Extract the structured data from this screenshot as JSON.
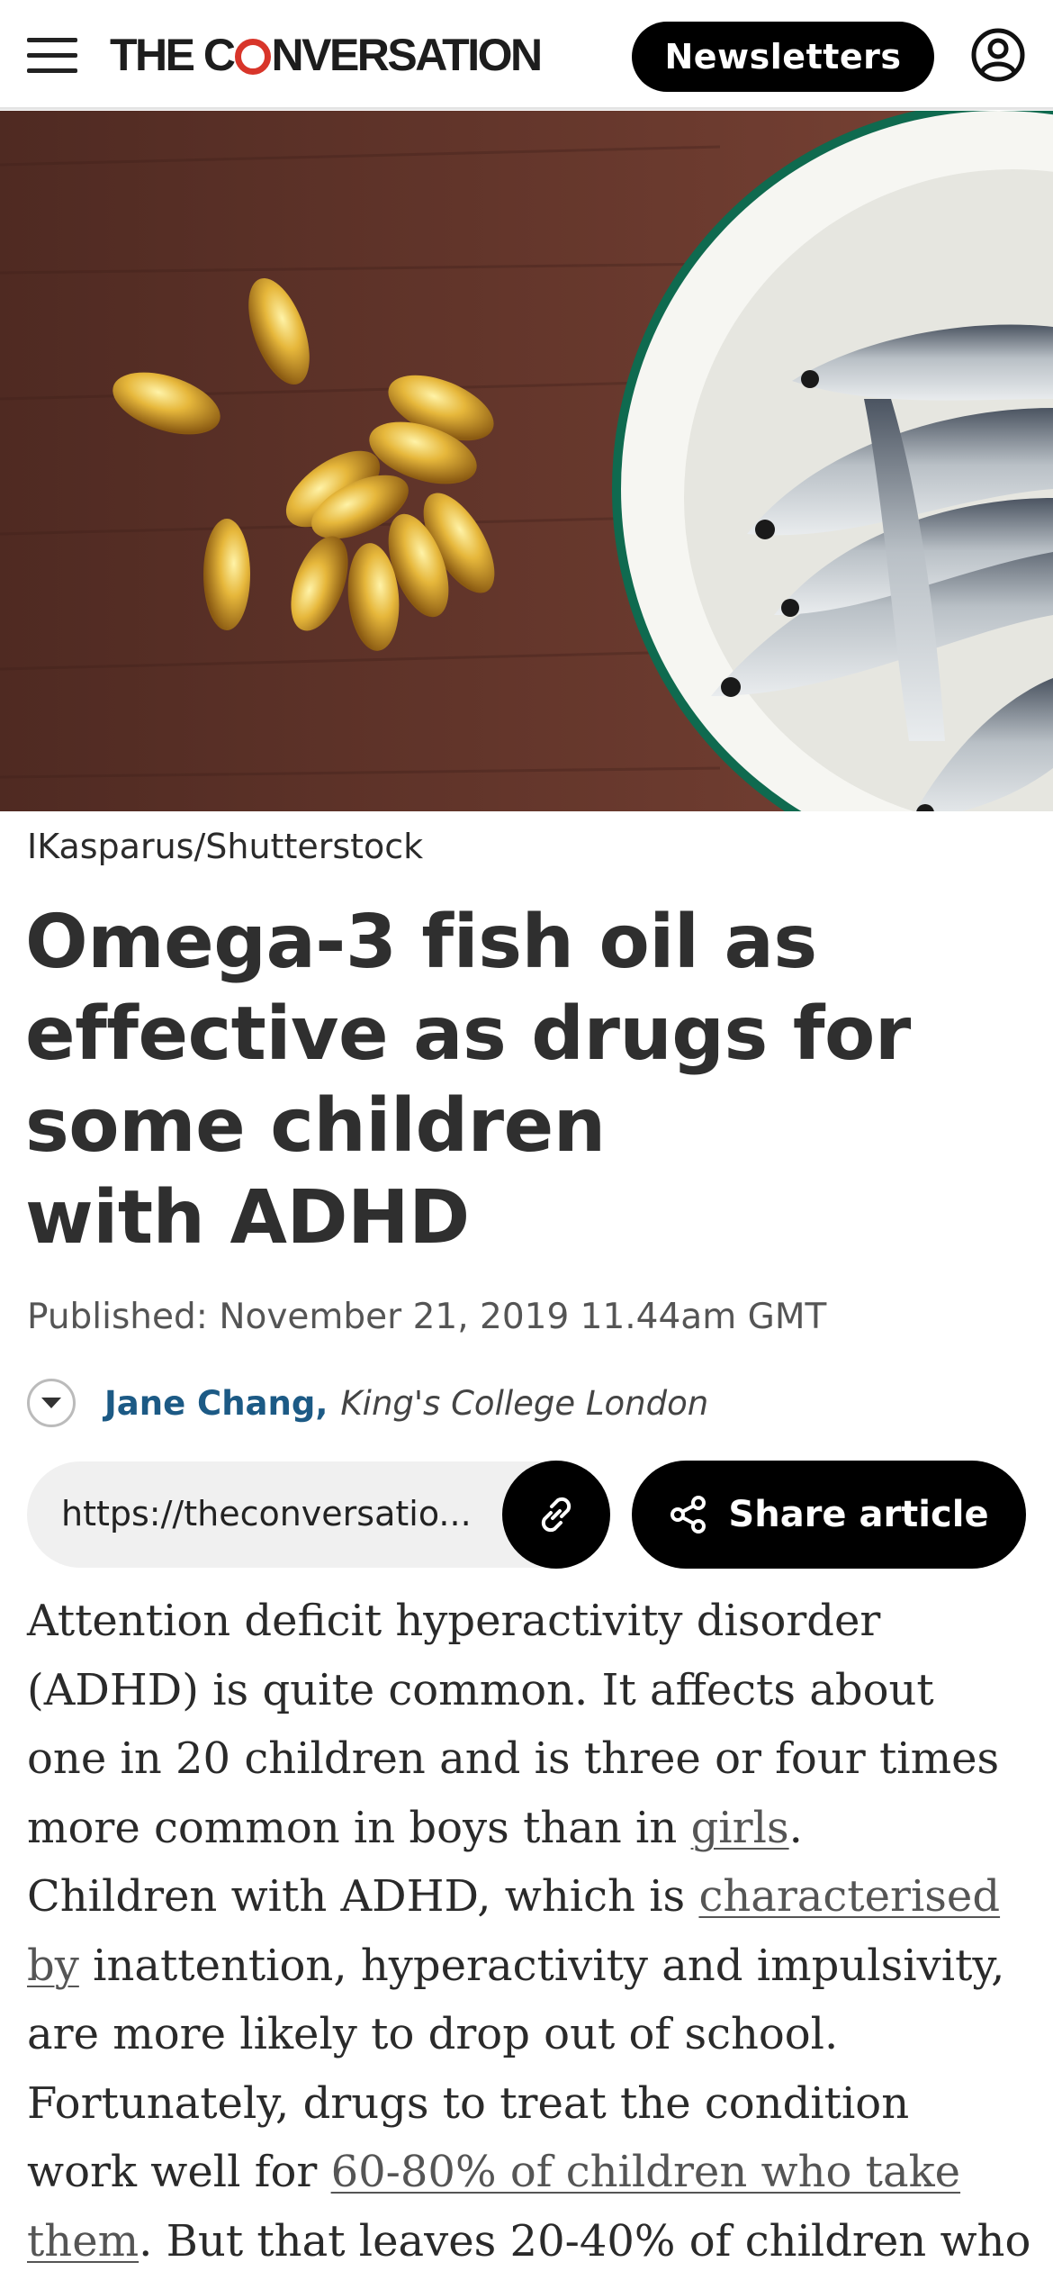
{
  "header": {
    "logo_prefix": "THE C",
    "logo_suffix": "NVERSATION",
    "newsletters_label": "Newsletters"
  },
  "icons": {
    "menu": "hamburger-icon",
    "account": "user-circle-icon",
    "link": "link-icon",
    "share": "share-icon",
    "toggle": "chevron-down-icon"
  },
  "hero": {
    "caption": "IKasparus/Shutterstock"
  },
  "article": {
    "headline_lines": [
      "Omega-3 fish oil as",
      "effective as drugs for",
      "some children",
      "with ADHD"
    ],
    "published_label": "Published:",
    "published_date": "November 21, 2019 11.44am GMT",
    "author_name": "Jane Chang,",
    "author_affiliation": "King's College London",
    "url": "https://theconversatio...",
    "share_label": "Share article",
    "body": {
      "l1": "Attention deficit hyperactivity disorder",
      "l2": "(ADHD) is quite common. It affects about",
      "l3": "one in 20 children and is three or four times",
      "l4a": "more common in boys than in ",
      "l4_link": "girls",
      "l4b": ".",
      "l5a": "Children with ADHD, which is ",
      "l5_link": "characterised",
      "l6_link": "by",
      "l6b": " inattention, hyperactivity and impulsivity,",
      "l7": "are more likely to drop out of school.",
      "l8": "Fortunately, drugs to treat the condition",
      "l9a": "work well for ",
      "l9_link": "60-80% of children who take",
      "l10_link": "them",
      "l10b": ". But that leaves 20-40% of children who"
    }
  },
  "colors": {
    "brand_red": "#d8352a",
    "author_blue": "#1c5a85",
    "button_black": "#000000"
  }
}
